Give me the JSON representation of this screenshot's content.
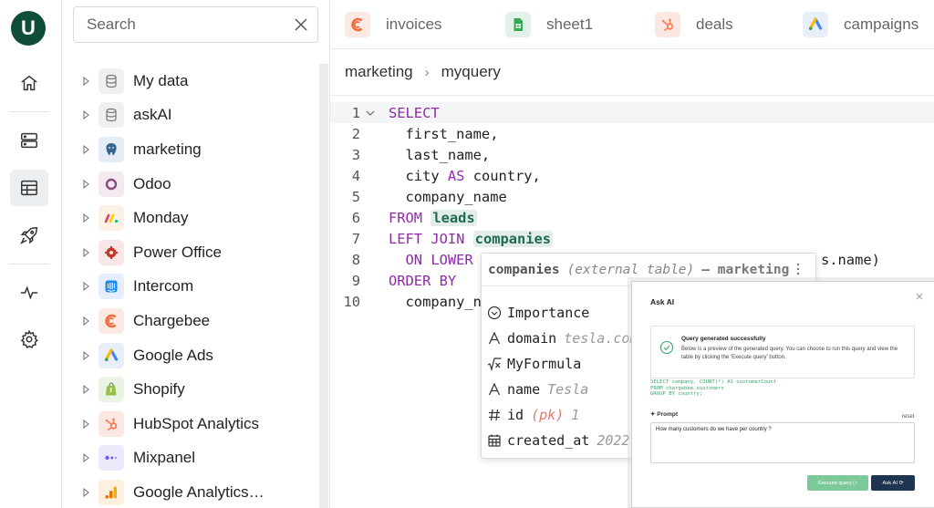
{
  "app": {
    "logo_letter": "U"
  },
  "search": {
    "placeholder": "Search"
  },
  "sources": [
    {
      "label": "My data",
      "icon": "database-icon"
    },
    {
      "label": "askAI",
      "icon": "database-icon"
    },
    {
      "label": "marketing",
      "icon": "postgres-icon"
    },
    {
      "label": "Odoo",
      "icon": "odoo-icon"
    },
    {
      "label": "Monday",
      "icon": "monday-icon"
    },
    {
      "label": "Power Office",
      "icon": "power-office-icon"
    },
    {
      "label": "Intercom",
      "icon": "intercom-icon"
    },
    {
      "label": "Chargebee",
      "icon": "chargebee-icon"
    },
    {
      "label": "Google Ads",
      "icon": "google-ads-icon"
    },
    {
      "label": "Shopify",
      "icon": "shopify-icon"
    },
    {
      "label": "HubSpot Analytics",
      "icon": "hubspot-icon"
    },
    {
      "label": "Mixpanel",
      "icon": "mixpanel-icon"
    },
    {
      "label": "Google Analytics…",
      "icon": "google-analytics-icon"
    }
  ],
  "tabs": [
    {
      "label": "invoices",
      "icon": "chargebee-icon"
    },
    {
      "label": "sheet1",
      "icon": "google-sheets-icon"
    },
    {
      "label": "deals",
      "icon": "hubspot-icon"
    },
    {
      "label": "campaigns",
      "icon": "google-ads-icon"
    }
  ],
  "breadcrumb": {
    "parent": "marketing",
    "current": "myquery"
  },
  "editor": {
    "lines": [
      {
        "n": "1"
      },
      {
        "n": "2"
      },
      {
        "n": "3"
      },
      {
        "n": "4"
      },
      {
        "n": "5"
      },
      {
        "n": "6"
      },
      {
        "n": "7"
      },
      {
        "n": "8"
      },
      {
        "n": "9"
      },
      {
        "n": "10"
      }
    ],
    "tokens": {
      "select": "SELECT",
      "l2": "  first_name,",
      "l3": "  last_name,",
      "l4a": "  city ",
      "l4kw": "AS",
      "l4b": " country,",
      "l5": "  company_name",
      "from": "FROM ",
      "leads": "leads",
      "leftjoin": "LEFT JOIN ",
      "companies": "companies",
      "l8a": "  ON LOWER",
      "l8b": "s.name)",
      "orderby": "ORDER BY",
      "l10": "  company_n"
    }
  },
  "table_info": {
    "name": "companies",
    "kind": "(external table)",
    "source": "– marketing",
    "fields": [
      {
        "name": "Importance",
        "value": "",
        "icon": "select-field-icon"
      },
      {
        "name": "domain",
        "value": "tesla.com",
        "icon": "text-field-icon"
      },
      {
        "name": "MyFormula",
        "value": "",
        "icon": "formula-field-icon"
      },
      {
        "name": "name",
        "value": "Tesla",
        "icon": "text-field-icon"
      },
      {
        "name": "id",
        "pk": "(pk)",
        "value": "1",
        "icon": "number-field-icon"
      },
      {
        "name": "created_at",
        "value": "2022-",
        "icon": "date-field-icon"
      }
    ]
  },
  "ask_ai": {
    "title": "Ask AI",
    "success_title": "Query generated successfully",
    "success_desc": "Below is a preview of the generated query. You can choose to run this query and view the table by clicking the 'Execute query' button.",
    "sql": "SELECT company, COUNT(*) AS customerCount\nFROM chargebee.customers\nGROUP BY country;",
    "prompt_label": "Prompt",
    "reset_label": "reset",
    "prompt_value": "How many customers do we have per country ?",
    "execute_label": "Execute query ▷",
    "ask_label": "Ask AI ⟳"
  },
  "colors": {
    "brand": "#0d4d3a",
    "keyword": "#8f2aa8",
    "table_token": "#1e6b54",
    "execute": "#7ec99b",
    "ask": "#1e3552"
  }
}
